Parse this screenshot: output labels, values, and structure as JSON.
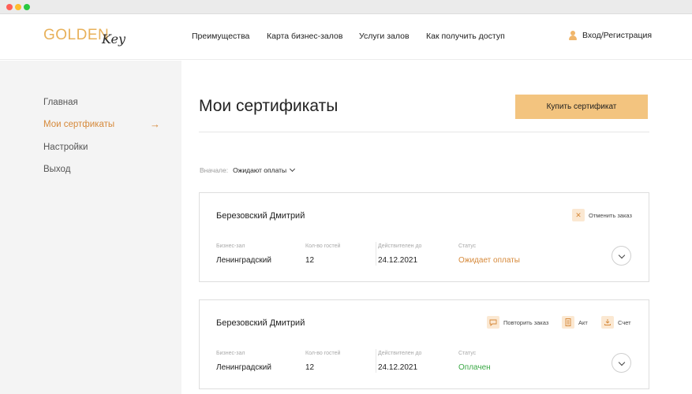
{
  "header": {
    "logo_text": "GOLDEN",
    "logo_script": "Key",
    "nav": [
      "Преимущества",
      "Карта бизнес-залов",
      "Услуги залов",
      "Как получить доступ"
    ],
    "login_label": "Вход/Регистрация"
  },
  "sidebar": {
    "items": [
      {
        "label": "Главная",
        "active": false
      },
      {
        "label": "Мои сертфикаты",
        "active": true
      },
      {
        "label": "Настройки",
        "active": false
      },
      {
        "label": "Выход",
        "active": false
      }
    ]
  },
  "main": {
    "title": "Мои сертификаты",
    "buy_label": "Купить сертификат",
    "sort_label": "Вначале:",
    "sort_value": "Ожидают оплаты"
  },
  "cards": [
    {
      "name": "Березовский Дмитрий",
      "labels": [
        "Бизнес-зал",
        "Кол-во гостей",
        "Действителен до",
        "Статус"
      ],
      "hall": "Ленинградский",
      "guests": "12",
      "valid_until": "24.12.2021",
      "status": "Ожидает оплаты",
      "status_color": "#d6893a",
      "actions": [
        {
          "label": "Отменить заказ",
          "icon": "close-icon"
        }
      ]
    },
    {
      "name": "Березовский Дмитрий",
      "labels": [
        "Бизнес-зал",
        "Кол-во гостей",
        "Действителен до",
        "Статус"
      ],
      "hall": "Ленинградский",
      "guests": "12",
      "valid_until": "24.12.2021",
      "status": "Оплачен",
      "status_color": "#3aa845",
      "actions": [
        {
          "label": "Повторить заказ",
          "icon": "chat-icon"
        },
        {
          "label": "Акт",
          "icon": "document-icon"
        },
        {
          "label": "Счет",
          "icon": "download-icon"
        }
      ]
    }
  ],
  "colors": {
    "accent": "#f3c47f",
    "accent_text": "#d6893a",
    "paid": "#3aa845"
  }
}
